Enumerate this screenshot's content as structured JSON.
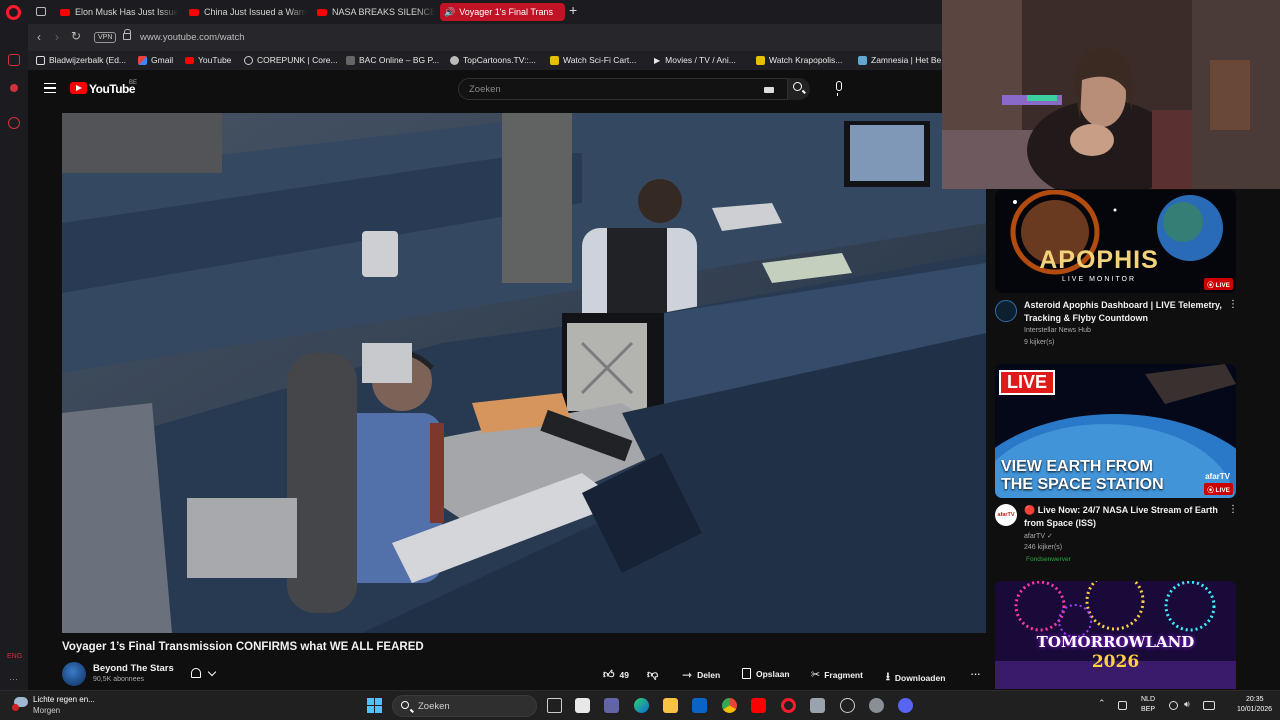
{
  "browser": {
    "tabs": [
      {
        "label": "Elon Musk Has Just Issue"
      },
      {
        "label": "China Just Issued a Warni"
      },
      {
        "label": "NASA BREAKS SILENCE o"
      },
      {
        "label": "Voyager 1's Final Trans",
        "active": true
      }
    ],
    "nav": {
      "back": "‹",
      "forward": "›",
      "reload": "↻",
      "vpn": "VPN"
    },
    "url": "www.youtube.com/watch",
    "bookmarks": [
      "Bladwijzerbalk (Ed...",
      "Gmail",
      "YouTube",
      "COREPUNK | Core...",
      "BAC Online – BG P...",
      "TopCartoons.TV::...",
      "Watch Sci-Fi Cart...",
      "Movies / TV / Ani...",
      "Watch Krapopolis...",
      "Zamnesia | Het Be"
    ],
    "sidebar_text": "ENG"
  },
  "youtube": {
    "logo_text": "YouTube",
    "region": "BE",
    "search_placeholder": "Zoeken"
  },
  "video": {
    "title": "Voyager 1’s Final Transmission CONFIRMS what WE ALL FEARED",
    "channel": "Beyond The Stars",
    "subscribers": "90,5K abonnees",
    "likes": "49",
    "actions": {
      "share": "Delen",
      "save": "Opslaan",
      "clip": "Fragment",
      "download": "Downloaden"
    }
  },
  "recommendations": [
    {
      "thumb_title": "APOPHIS",
      "thumb_subtitle": "LIVE MONITOR",
      "badge": "LIVE",
      "title_line1": "Asteroid Apophis Dashboard | LIVE Telemetry,",
      "title_line2": "Tracking & Flyby Countdown",
      "channel": "Interstellar News Hub",
      "meta": "9 kijker(s)"
    },
    {
      "thumb_live": "LIVE",
      "thumb_line1": "VIEW EARTH FROM",
      "thumb_line2": "THE SPACE STATION",
      "thumb_brand": "afarTV",
      "badge": "LIVE",
      "title_line1": "🔴 Live Now: 24/7 NASA Live Stream of Earth",
      "title_line2": "from Space (ISS)",
      "channel": "afarTV",
      "meta": "246 kijker(s)",
      "fund": "Fondsenwerver",
      "avatar_text": "afarTV"
    },
    {
      "thumb_line1": "TOMORROWLAND",
      "thumb_line2": "2026"
    }
  ],
  "taskbar": {
    "weather_line1": "Lichte regen en...",
    "weather_line2": "Morgen",
    "search_label": "Zoeken",
    "lang1": "NLD",
    "lang2": "BEP",
    "time": "20:35",
    "date": "10/01/2026"
  }
}
